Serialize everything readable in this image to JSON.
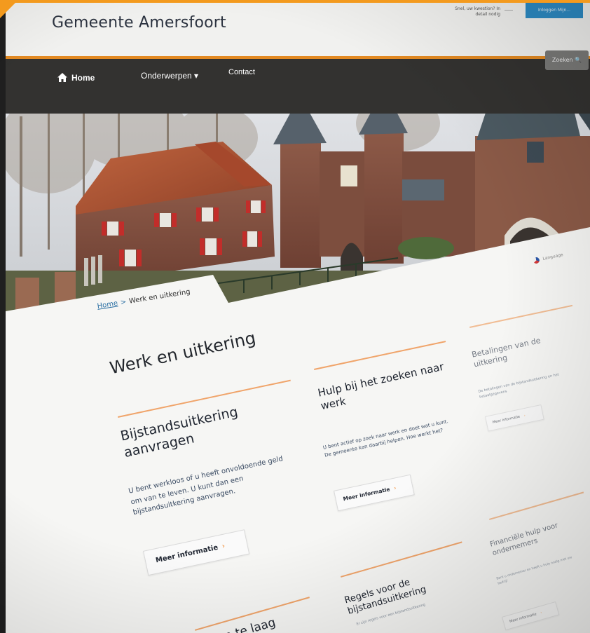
{
  "header": {
    "site_title": "Gemeente Amersfoort",
    "note": "Snel, uw kwestion? In detail nodig",
    "button_label": "Inloggen Mijn..."
  },
  "nav": {
    "home": "Home",
    "topics": "Onderwerpen ▾",
    "contact": "Contact",
    "search": "Zoeken 🔍"
  },
  "lang": {
    "label": "Language"
  },
  "breadcrumb": {
    "home": "Home",
    "separator": ">",
    "current": "Werk en uitkering"
  },
  "page_title": "Werk en uitkering",
  "cards": [
    {
      "title": "Bijstandsuitkering aanvragen",
      "body": "U bent werkloos of u heeft onvoldoende geld om van te leven. U kunt dan een bijstandsuitkering aanvragen.",
      "button": "Meer informatie"
    },
    {
      "title": "Hulp bij het zoeken naar werk",
      "body": "U bent actief op zoek naar werk en doet wat u kunt. De gemeente kan daarbij helpen. Hoe werkt het?",
      "button": "Meer informatie"
    },
    {
      "title": "Betalingen van de uitkering",
      "body": "De betalingen van de bijstandsuitkering en het betaalgegevens",
      "button": "Meer informatie"
    },
    {
      "title": "Regels voor de bijstandsuitkering",
      "body": "Er zijn regels voor een bijstandsuitkering",
      "button": ""
    },
    {
      "title": "Financiële hulp voor ondernemers",
      "body": "Bent u ondernemer en heeft u hulp nodig met uw bedrijf",
      "button": "Meer informatie"
    },
    {
      "title": "Inkomen te laag",
      "body": "",
      "button": ""
    }
  ],
  "colors": {
    "accent": "#f39a1e",
    "nav_bg": "#333230",
    "link": "#2a6fa3",
    "header_button": "#2d8bc4"
  }
}
